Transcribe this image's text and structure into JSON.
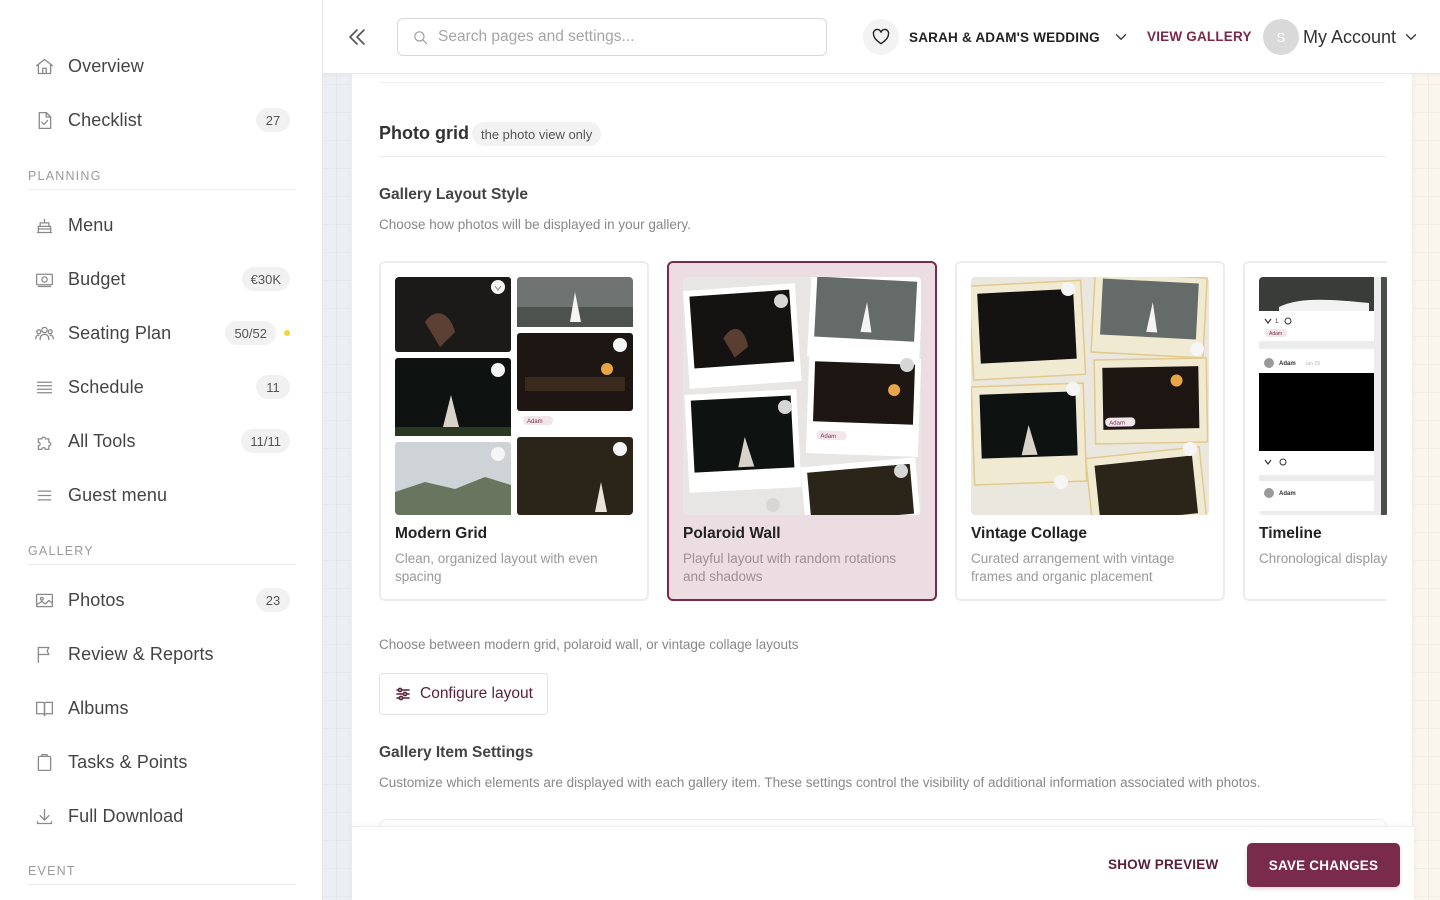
{
  "sidebar": {
    "items": [
      {
        "label": "Overview",
        "icon": "home-icon"
      },
      {
        "label": "Checklist",
        "icon": "checklist-icon",
        "badge": "27"
      }
    ],
    "sections": {
      "planning": "PLANNING",
      "gallery": "GALLERY",
      "event": "EVENT"
    },
    "planning": [
      {
        "label": "Menu",
        "icon": "cake-icon"
      },
      {
        "label": "Budget",
        "icon": "money-icon",
        "badge": "€30K"
      },
      {
        "label": "Seating Plan",
        "icon": "users-icon",
        "badge": "50/52"
      },
      {
        "label": "Schedule",
        "icon": "schedule-icon",
        "badge": "11"
      },
      {
        "label": "All Tools",
        "icon": "puzzle-icon",
        "badge": "11/11"
      },
      {
        "label": "Guest menu",
        "icon": "hamburger-icon"
      }
    ],
    "gallery": [
      {
        "label": "Photos",
        "icon": "image-icon",
        "badge": "23"
      },
      {
        "label": "Review & Reports",
        "icon": "flag-icon"
      },
      {
        "label": "Albums",
        "icon": "book-icon"
      },
      {
        "label": "Tasks & Points",
        "icon": "clipboard-icon"
      },
      {
        "label": "Full Download",
        "icon": "download-icon"
      }
    ],
    "status_dot_color": "#f3d43a"
  },
  "header": {
    "search_placeholder": "Search pages and settings...",
    "event_name": "SARAH & ADAM'S WEDDING",
    "view_gallery": "VIEW GALLERY",
    "avatar_initial": "S",
    "account_label": "My Account"
  },
  "main": {
    "title": "Photo grid",
    "title_badge": "the photo view only",
    "layout_heading": "Gallery Layout Style",
    "layout_desc": "Choose how photos will be displayed in your gallery.",
    "cards": [
      {
        "name": "Modern Grid",
        "desc": "Clean, organized layout with even spacing",
        "selected": false
      },
      {
        "name": "Polaroid Wall",
        "desc": "Playful layout with random rotations and shadows",
        "selected": true
      },
      {
        "name": "Vintage Collage",
        "desc": "Curated arrangement with vintage frames and organic placement",
        "selected": false
      },
      {
        "name": "Timeline",
        "desc": "Chronological display with date markers and event milestones",
        "selected": false
      }
    ],
    "thumb_tags": {
      "adam": "Adam",
      "jan29": "Jan 29",
      "likes": "1"
    },
    "layout_hint": "Choose between modern grid, polaroid wall, or vintage collage layouts",
    "configure_label": "Configure layout",
    "item_heading": "Gallery Item Settings",
    "item_desc": "Customize which elements are displayed with each gallery item. These settings control the visibility of additional information associated with photos."
  },
  "footer": {
    "show_preview": "SHOW PREVIEW",
    "save_changes": "SAVE CHANGES"
  },
  "colors": {
    "accent": "#7a2a4a",
    "selected_card_bg": "#ecdde3"
  }
}
